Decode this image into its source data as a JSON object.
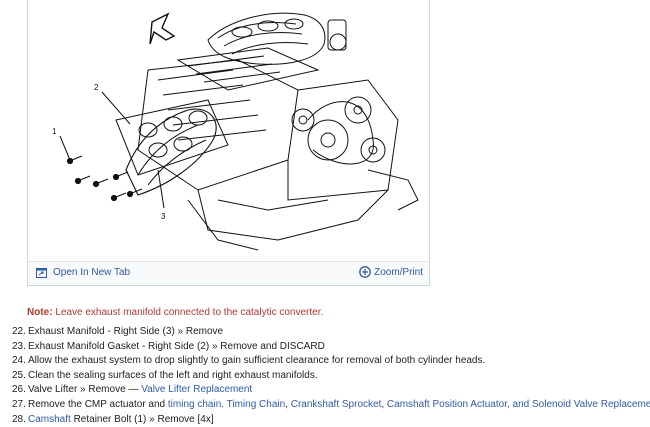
{
  "figure": {
    "callouts": [
      "1",
      "2",
      "3"
    ],
    "open_tab_label": "Open In New Tab",
    "zoom_print_label": "Zoom/Print"
  },
  "note": {
    "label": "Note:",
    "text": "Leave exhaust manifold connected to the catalytic converter."
  },
  "steps": [
    {
      "num": "22.",
      "text": "Exhaust Manifold - Right Side (3) » Remove"
    },
    {
      "num": "23.",
      "text": "Exhaust Manifold Gasket - Right Side (2) » Remove and DISCARD"
    },
    {
      "num": "24.",
      "text": "Allow the exhaust system to drop slightly to gain sufficient clearance for removal of both cylinder heads."
    },
    {
      "num": "25.",
      "text": "Clean the sealing surfaces of the left and right exhaust manifolds."
    },
    {
      "num": "26.",
      "text": "Valve Lifter » Remove — ",
      "link": "Valve Lifter Replacement"
    },
    {
      "num": "27.",
      "text": "Remove the CMP actuator and ",
      "link": "timing chain.",
      "link2": "Timing Chain",
      "link3": "Crankshaft Sprocket",
      "link4": "Camshaft Position Actuator, and Solenoid Valve Replacement"
    },
    {
      "num": "28.",
      "link": "Camshaft",
      "text": " Retainer Bolt (1) » Remove [4x]"
    }
  ]
}
